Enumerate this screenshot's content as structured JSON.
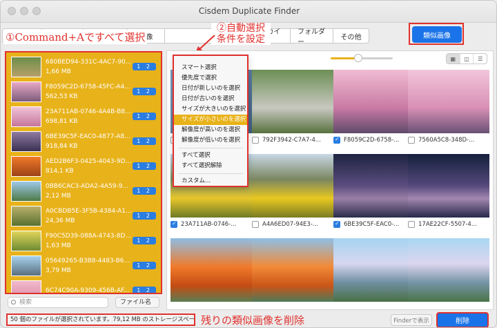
{
  "window": {
    "title": "Cisdem Duplicate Finder"
  },
  "tabs": [
    {
      "label": ""
    },
    {
      "label": ""
    },
    {
      "label": "ント"
    },
    {
      "label": "画像"
    },
    {
      "label": ""
    },
    {
      "label": "アーカイブ"
    },
    {
      "label": "フォルダー"
    },
    {
      "label": "その他"
    }
  ],
  "similar_button": {
    "label": "類似画像"
  },
  "annotations": {
    "step1": "①Command+Aですべて選択",
    "step2_line1": "②自動選択",
    "step2_line2": "条件を設定",
    "bottom": "残りの類似画像を削除"
  },
  "groups": [
    {
      "name": "680BED94-331C-4AC7-90...",
      "size": "1,66 MB",
      "badge": "1 2"
    },
    {
      "name": "F8059C2D-6758-45FC-A4...",
      "size": "562,53 KB",
      "badge": "1 2"
    },
    {
      "name": "23A711AB-0746-4A4B-B8...",
      "size": "698,81 KB",
      "badge": "1 2"
    },
    {
      "name": "6BE39C5F-EAC0-4877-A8...",
      "size": "918,84 KB",
      "badge": "1 2"
    },
    {
      "name": "AED2B6F3-0425-4043-9D...",
      "size": "814,1 KB",
      "badge": "1 2"
    },
    {
      "name": "0BB6CAC3-ADA2-4A59-9...",
      "size": "2,12 MB",
      "badge": "1 2"
    },
    {
      "name": "A0CBDB5E-3F5B-4384-A1...",
      "size": "24,36 MB",
      "badge": "1 2"
    },
    {
      "name": "F90C5D39-088A-4743-8D...",
      "size": "1,63 MB",
      "badge": "1 2"
    },
    {
      "name": "05649265-B3B8-4483-B6...",
      "size": "3,79 MB",
      "badge": "1 2"
    },
    {
      "name": "6C74C90A-9309-456B-AF...",
      "size": "",
      "badge": "1 2"
    }
  ],
  "search": {
    "placeholder": "検索"
  },
  "sort": {
    "value": "ファイル名"
  },
  "menu": {
    "items_a": [
      "スマート選択",
      "優先度で選択",
      "日付が新しいのを選択",
      "日付が古いのを選択",
      "サイズが大きいのを選択",
      "サイズが小さいのを選択",
      "解像度が高いのを選択",
      "解像度が低いのを選択"
    ],
    "items_b": [
      "すべて選択",
      "すべて選択解除"
    ],
    "items_c": [
      "カスタム..."
    ]
  },
  "images": [
    {
      "caption": "",
      "checked": false
    },
    {
      "caption": "792F3942-C7A7-4...",
      "checked": false
    },
    {
      "caption": "F8059C2D-6758-...",
      "checked": true
    },
    {
      "caption": "7560A5C8-348D-...",
      "checked": false
    },
    {
      "caption": "23A711AB-0746-...",
      "checked": true
    },
    {
      "caption": "A4A6ED07-94E3-...",
      "checked": false
    },
    {
      "caption": "6BE39C5F-EAC0-...",
      "checked": true
    },
    {
      "caption": "17AE22CF-5507-4...",
      "checked": false
    },
    {
      "caption": "",
      "checked": false
    },
    {
      "caption": "",
      "checked": false
    },
    {
      "caption": "",
      "checked": false
    },
    {
      "caption": "",
      "checked": false
    }
  ],
  "status": {
    "text": "50 個のファイルが選択されています。79,12 MB のストレージスペースが解"
  },
  "buttons": {
    "finder": "Finderで表示",
    "delete": "削除"
  },
  "colors": {
    "accent_blue": "#1a73e8",
    "selection_yellow": "#e8b21a",
    "annotation_red": "#e0312d"
  }
}
